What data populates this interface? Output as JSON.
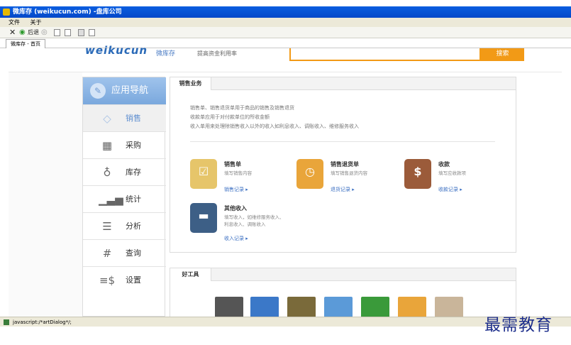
{
  "window": {
    "title": "微库存 (weikucun.com) -盘库公司"
  },
  "menu": {
    "items": [
      "文件",
      "关于"
    ]
  },
  "toolbar": {
    "back_label": "后退"
  },
  "tabs": [
    {
      "label": "微库存 - 首页"
    }
  ],
  "header": {
    "logo_text": "weikucun",
    "logo_cn": "微库存",
    "slogan": "提高资金利用率",
    "search_placeholder": "",
    "search_button": "搜索"
  },
  "sidebar": {
    "title": "应用导航",
    "items": [
      {
        "label": "销售",
        "icon": "tag-icon",
        "active": true
      },
      {
        "label": "采购",
        "icon": "basket-icon"
      },
      {
        "label": "库存",
        "icon": "money-bag-icon"
      },
      {
        "label": "统计",
        "icon": "bar-chart-icon"
      },
      {
        "label": "分析",
        "icon": "list-icon"
      },
      {
        "label": "查询",
        "icon": "grid-icon"
      },
      {
        "label": "设置",
        "icon": "settings-icon"
      }
    ]
  },
  "sales_panel": {
    "tab": "销售业务",
    "lines": [
      "销售单、销售退货单用于商品的销售及销售退货",
      "收款单应用于对付款单位的所收金额",
      "收入单用来处理除销售收入以外的收入如利息收入、调账收入、维修服务收入"
    ],
    "items": [
      {
        "title": "销售单",
        "desc": "填写销售内容",
        "link": "销售记录 ▸",
        "icon": "sales-order-icon",
        "color": "#e9c46a"
      },
      {
        "title": "销售退货单",
        "desc": "填写销售退货内容",
        "link": "退货记录 ▸",
        "icon": "return-order-icon",
        "color": "#e9a53a"
      },
      {
        "title": "收款",
        "desc": "填写应收款项",
        "link": "收款记录 ▸",
        "icon": "receipt-icon",
        "color": "#9b5b3a"
      },
      {
        "title": "其他收入",
        "desc": "填写收入，如维修服务收入、利息收入、调账收入",
        "link": "收入记录 ▸",
        "icon": "other-income-icon",
        "color": "#3d5f86"
      }
    ]
  },
  "tools_panel": {
    "tab": "好工具"
  },
  "status": {
    "text": "javascript:/*artDialog*/;"
  },
  "watermark": "最需教育"
}
